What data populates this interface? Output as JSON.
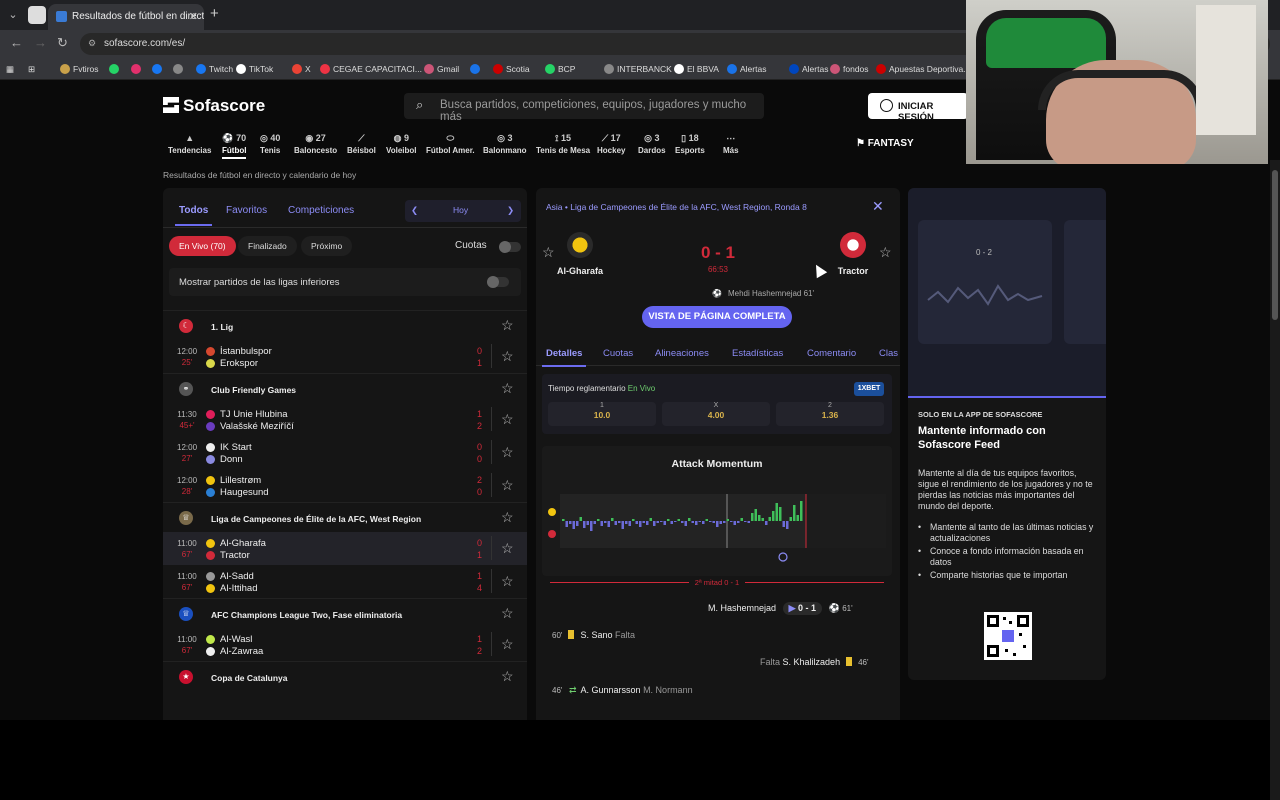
{
  "browser": {
    "tab_title": "Resultados de fútbol en directo",
    "url": "sofascore.com/es/",
    "bookmarks": [
      "Fvtiros",
      "Twitch",
      "TikTok",
      "X",
      "CEGAE CAPACITACI...",
      "Gmail",
      "Scotia",
      "BCP",
      "INTERBANCK",
      "El BBVA",
      "Alertas",
      "Alertas",
      "fondos",
      "Apuestas Deportiva..."
    ]
  },
  "header": {
    "logo": "Sofascore",
    "search_placeholder": "Busca partidos, competiciones, equipos, jugadores y mucho más",
    "login": "INICIAR SESIÓN",
    "fantasy": "FANTASY"
  },
  "sports": [
    {
      "label": "Tendencias",
      "count": ""
    },
    {
      "label": "Fútbol",
      "count": "70"
    },
    {
      "label": "Tenis",
      "count": "40"
    },
    {
      "label": "Baloncesto",
      "count": "27"
    },
    {
      "label": "Béisbol",
      "count": ""
    },
    {
      "label": "Voleibol",
      "count": "9"
    },
    {
      "label": "Fútbol Amer.",
      "count": ""
    },
    {
      "label": "Balonmano",
      "count": "3"
    },
    {
      "label": "Tenis de Mesa",
      "count": "15"
    },
    {
      "label": "Hockey",
      "count": "17"
    },
    {
      "label": "Dardos",
      "count": "3"
    },
    {
      "label": "Esports",
      "count": "18"
    },
    {
      "label": "Más",
      "count": ""
    }
  ],
  "breadcrumb": "Resultados de fútbol en directo y calendario de hoy",
  "left": {
    "tabs": [
      "Todos",
      "Favoritos",
      "Competiciones"
    ],
    "date": "Hoy",
    "filters": [
      "En Vivo (70)",
      "Finalizado",
      "Próximo"
    ],
    "odds_label": "Cuotas",
    "lower_leagues": "Mostrar partidos de las ligas inferiores",
    "leagues": [
      {
        "name": "1. Lig",
        "matches": [
          {
            "time": "12:00",
            "min": "25'",
            "home": "İstanbulspor",
            "away": "Erokspor",
            "sh": "0",
            "sa": "1"
          }
        ]
      },
      {
        "name": "Club Friendly Games",
        "matches": [
          {
            "time": "11:30",
            "min": "45+'",
            "home": "TJ Unie Hlubina",
            "away": "Valašské Meziříčí",
            "sh": "1",
            "sa": "2"
          },
          {
            "time": "12:00",
            "min": "27'",
            "home": "IK Start",
            "away": "Donn",
            "sh": "0",
            "sa": "0"
          },
          {
            "time": "12:00",
            "min": "28'",
            "home": "Lillestrøm",
            "away": "Haugesund",
            "sh": "2",
            "sa": "0"
          }
        ]
      },
      {
        "name": "Liga de Campeones de Élite de la AFC, West Region",
        "matches": [
          {
            "time": "11:00",
            "min": "67'",
            "home": "Al-Gharafa",
            "away": "Tractor",
            "sh": "0",
            "sa": "1"
          },
          {
            "time": "11:00",
            "min": "67'",
            "home": "Al-Sadd",
            "away": "Al-Ittihad",
            "sh": "1",
            "sa": "4"
          }
        ]
      },
      {
        "name": "AFC Champions League Two, Fase eliminatoria",
        "matches": [
          {
            "time": "11:00",
            "min": "67'",
            "home": "Al-Wasl",
            "away": "Al-Zawraa",
            "sh": "1",
            "sa": "2"
          }
        ]
      },
      {
        "name": "Copa de Catalunya",
        "matches": []
      }
    ]
  },
  "detail": {
    "competition": "Asia  •  Liga de Campeones de Élite de la AFC, West Region, Ronda 8",
    "home": "Al-Gharafa",
    "away": "Tractor",
    "score": "0 - 1",
    "minute": "66:53",
    "scorer": "Mehdi Hashemnejad 61'",
    "full_page": "VISTA DE PÁGINA COMPLETA",
    "tabs": [
      "Detalles",
      "Cuotas",
      "Alineaciones",
      "Estadísticas",
      "Comentario",
      "Clas"
    ],
    "odds": {
      "label": "Tiempo reglamentario",
      "live": "En Vivo",
      "bookie": "1XBET",
      "options": [
        {
          "k": "1",
          "v": "10.0"
        },
        {
          "k": "X",
          "v": "4.00"
        },
        {
          "k": "2",
          "v": "1.36"
        }
      ]
    },
    "momentum_title": "Attack Momentum",
    "half": "2ª mitad 0 - 1",
    "events": {
      "goal_player": "M. Hashemnejad",
      "goal_score": "0 - 1",
      "goal_min": "61'",
      "e1_min": "60'",
      "e1_player": "S. Sano",
      "e1_type": "Falta",
      "e2_type": "Falta",
      "e2_player": "S. Khalilzadeh",
      "e2_min": "46'",
      "e3_min": "46'",
      "e3_in": "A. Gunnarsson",
      "e3_out": "M. Normann"
    }
  },
  "promo": {
    "card_score": "0 - 2",
    "tag": "SOLO EN LA APP DE SOFASCORE",
    "title": "Mantente informado con Sofascore Feed",
    "desc": "Mantente al día de tus equipos favoritos, sigue el rendimiento de los jugadores y no te pierdas las noticias más importantes del mundo del deporte.",
    "bullets": [
      "Mantente al tanto de las últimas noticias y actualizaciones",
      "Conoce a fondo información basada en datos",
      "Comparte historias que te importan"
    ]
  },
  "colors": {
    "accent": "#6464f0",
    "live": "#d12a3a",
    "bg": "#0a0a0a"
  }
}
